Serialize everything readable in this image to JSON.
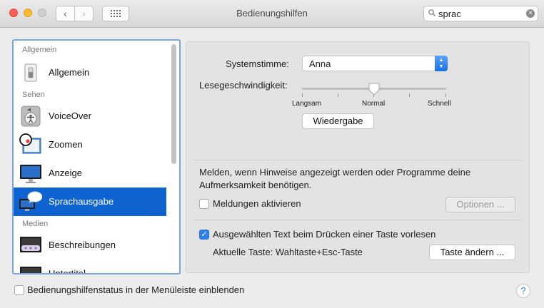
{
  "window": {
    "title": "Bedienungshilfen"
  },
  "search": {
    "value": "sprac"
  },
  "sidebar": {
    "sections": [
      "Allgemein",
      "Sehen",
      "Medien"
    ],
    "items": [
      {
        "label": "Allgemein",
        "icon": "switch-icon"
      },
      {
        "label": "VoiceOver",
        "icon": "voiceover-icon"
      },
      {
        "label": "Zoomen",
        "icon": "magnifier-icon"
      },
      {
        "label": "Anzeige",
        "icon": "display-icon"
      },
      {
        "label": "Sprachausgabe",
        "icon": "speech-icon",
        "selected": true
      },
      {
        "label": "Beschreibungen",
        "icon": "descriptions-icon"
      },
      {
        "label": "Untertitel",
        "icon": "subtitles-icon"
      }
    ]
  },
  "speech": {
    "voice_label": "Systemstimme:",
    "voice_value": "Anna",
    "rate_label": "Lesegeschwindigkeit:",
    "rate_ticks": [
      "Langsam",
      "Normal",
      "Schnell"
    ],
    "rate_value_fraction": 0.5,
    "play_button": "Wiedergabe"
  },
  "announce": {
    "description": "Melden, wenn Hinweise angezeigt werden oder Programme deine Aufmerksamkeit benötigen.",
    "checkbox_label": "Meldungen aktivieren",
    "checkbox_checked": false,
    "options_button": "Optionen ..."
  },
  "selection": {
    "checkbox_label": "Ausgewählten Text beim Drücken einer Taste vorlesen",
    "checkbox_checked": true,
    "current_key_label": "Aktuelle Taste: Wahltaste+Esc-Taste",
    "change_key_button": "Taste ändern ..."
  },
  "footer": {
    "status_checkbox_label": "Bedienungshilfenstatus in der Menüleiste einblenden",
    "status_checkbox_checked": false,
    "help_label": "?"
  },
  "colors": {
    "accent": "#0f63d1",
    "focus_ring": "#77a8e3"
  }
}
